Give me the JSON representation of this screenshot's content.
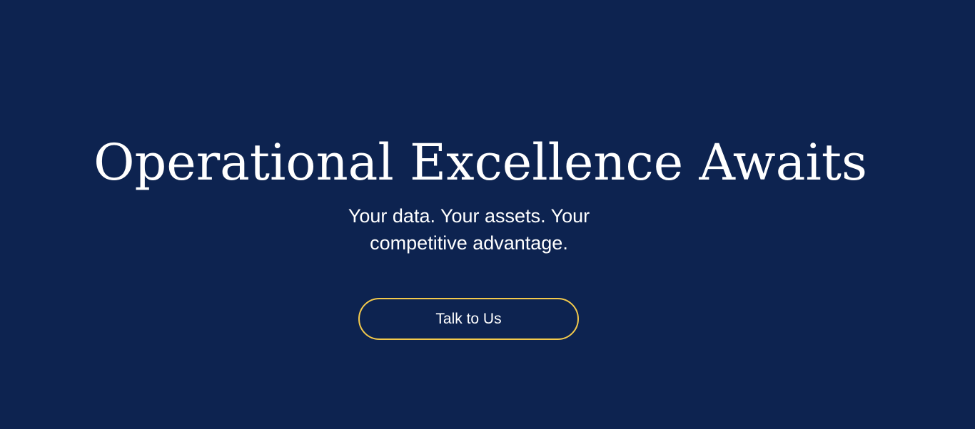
{
  "hero": {
    "title": "Operational Excellence Awaits",
    "subtitle": "Your data. Your assets. Your competitive advantage.",
    "cta_label": "Talk to Us"
  },
  "colors": {
    "background": "#0d2350",
    "text": "#ffffff",
    "cta_border": "#f2c94c"
  }
}
